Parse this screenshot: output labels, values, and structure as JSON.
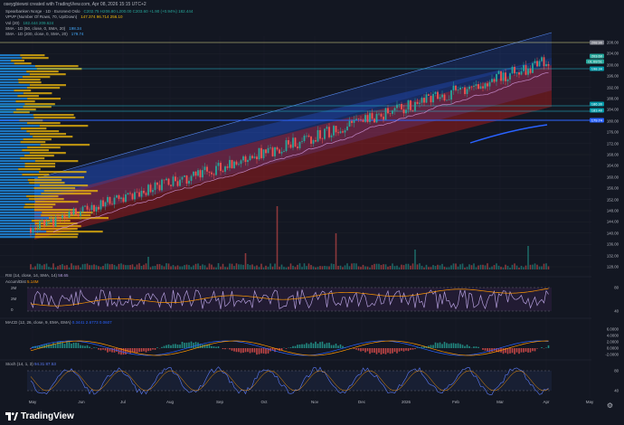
{
  "header": {
    "caption": "oseygbiewoi created with TradingView.com, Apr 08, 2026 15:15 UTC+2"
  },
  "legend": {
    "symbol": "Spearbanken Norge · 1D · Euronext Oslo",
    "ohlc": "C202.75 H206.80 L200.00 C203.60 +1.90 (+0.94%) 182.444",
    "vpvp": "VPVP (Number Of Rows, 70, Up/Down)",
    "vpvp_values": "147.374  96.714  256.10",
    "vol": "Vol (20)",
    "vol_values": "182.444  209.624",
    "sma50": "SMA · 1D (50, close, 0, SMA, 20)",
    "sma50_value": "198.34",
    "sma200": "SMA · 1D (200, close, 0, SMA, 20)",
    "sma200_value": "179.74"
  },
  "price_labels": {
    "top": "208.90",
    "current": "203.60",
    "current_time": "01:09:51",
    "sma50": "198.34",
    "l1": "186.30",
    "l2": "183.40",
    "sma200": "179.74"
  },
  "yaxis_ticks": [
    "208.00",
    "204.00",
    "200.00",
    "196.00",
    "192.00",
    "188.00",
    "184.00",
    "180.00",
    "176.00",
    "172.00",
    "168.00",
    "164.00",
    "160.00",
    "156.00",
    "152.00",
    "148.00",
    "144.00",
    "140.00",
    "136.00",
    "132.00",
    "128.00"
  ],
  "rsi": {
    "legend": "RSI (14, close, 14, SMA, 14)",
    "value": "58.65",
    "accum_legend": "Accum/Dist",
    "accum_value": "5.14M",
    "ticks": [
      "80",
      "40"
    ],
    "labels": [
      "2M",
      "2M",
      "0"
    ]
  },
  "macd": {
    "legend": "MACD (12, 26, close, 9, EMA, EMA)",
    "values": "0.3441  2.6773  0.0607",
    "ticks": [
      "6.0000",
      "4.0000",
      "2.0000",
      "0.0000",
      "-2.0000"
    ]
  },
  "stoch": {
    "legend": "Stoch (14, 1, 3)",
    "values": "94.31  87.53",
    "ticks": [
      "80",
      "40"
    ]
  },
  "xaxis": [
    "May",
    "Jun",
    "Jul",
    "Aug",
    "Sep",
    "Oct",
    "Nov",
    "Dec",
    "2026",
    "Feb",
    "Mar",
    "Apr",
    "May"
  ],
  "footer": {
    "brand": "TradingView"
  },
  "colors": {
    "bg": "#131722",
    "up": "#26a69a",
    "down": "#ef5350",
    "channel_upper": "#2962ff",
    "channel_lower": "#ef5350",
    "vp": "#f0b90b",
    "vp_blue": "#2196f3"
  }
}
